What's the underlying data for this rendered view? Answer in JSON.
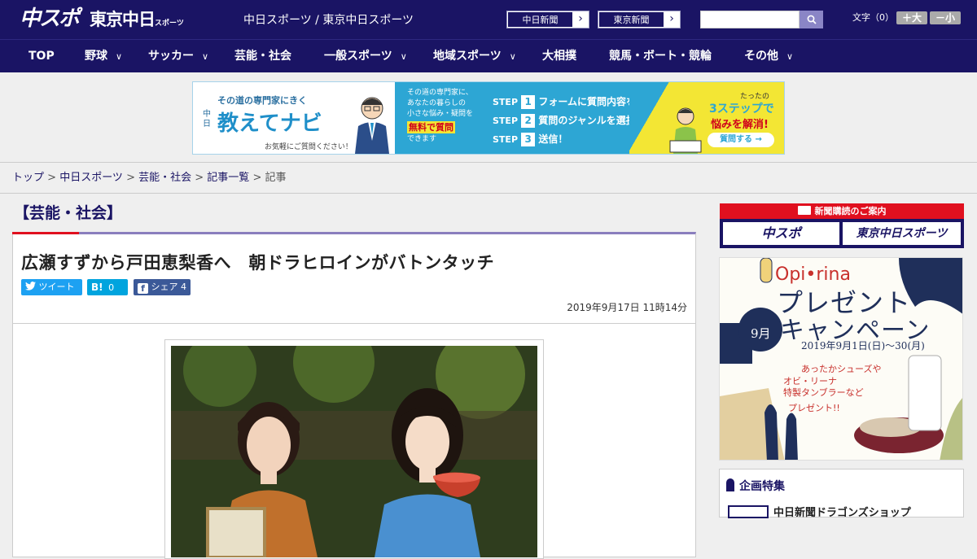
{
  "header": {
    "logo_main": "中スポ",
    "logo_tokyo": "東京中日",
    "logo_tokyo_sub": "スポーツ",
    "site_name": "中日スポーツ / 東京中日スポーツ",
    "paper_links": [
      "中日新聞",
      "東京新聞"
    ],
    "search_placeholder": "",
    "font_size_label": "文字（0）",
    "font_bigger": "＋大",
    "font_smaller": "－小"
  },
  "nav": [
    {
      "label": "TOP",
      "dropdown": false
    },
    {
      "label": "野球",
      "dropdown": true
    },
    {
      "label": "サッカー",
      "dropdown": true
    },
    {
      "label": "芸能・社会",
      "dropdown": false
    },
    {
      "label": "一般スポーツ",
      "dropdown": true
    },
    {
      "label": "地域スポーツ",
      "dropdown": true
    },
    {
      "label": "大相撲",
      "dropdown": false
    },
    {
      "label": "競馬・ボート・競輪",
      "dropdown": false
    },
    {
      "label": "その他",
      "dropdown": true
    }
  ],
  "banner": {
    "tagline": "その道の専門家にきく",
    "brand_prefix": "中日",
    "brand": "教えてナビ",
    "note": "お気軽にご質問ください！",
    "mid_lines": [
      "その道の専門家に、",
      "あなたの暮らしの",
      "小さな悩み・疑問を"
    ],
    "mid_highlight": "無料で質問",
    "mid_tail": "できます",
    "steps": [
      {
        "num": "1",
        "text": "フォームに質問内容を入力"
      },
      {
        "num": "2",
        "text": "質問のジャンルを選択"
      },
      {
        "num": "3",
        "text": "送信！"
      }
    ],
    "step_word": "STEP",
    "right_small": "たったの",
    "right_big": "3ステップで",
    "right_big2": "悩みを解消!",
    "right_button": "質問する"
  },
  "breadcrumb": [
    "トップ",
    "中日スポーツ",
    "芸能・社会",
    "記事一覧",
    "記事"
  ],
  "article": {
    "category": "【芸能・社会】",
    "headline": "広瀬すずから戸田恵梨香へ　朝ドラヒロインがバトンタッチ",
    "share": {
      "tweet": "ツイート",
      "hatena_count": "0",
      "facebook": "シェア",
      "facebook_count": "4"
    },
    "date": "2019年9月17日 11時14分"
  },
  "sidebar": {
    "subscribe_title": "新聞購読のご案内",
    "subscribe_buttons": [
      "中スポ",
      "東京中日スポーツ"
    ],
    "ad": {
      "brand": "Opi•rina",
      "title1": "プレゼント",
      "title2": "キャンペーン",
      "month": "9月",
      "period": "2019年9月1日(日)〜30(月)",
      "copy1": "あったかシューズや",
      "copy2": "オビ・リーナ",
      "copy3": "特製タンブラーなど",
      "copy4": "プレゼント!!"
    },
    "feature_title": "企画特集",
    "feature_item": "中日新聞ドラゴンズショップ"
  },
  "colors": {
    "navy": "#1a1464",
    "accent_red": "#e0101f",
    "twitter": "#1da1f2",
    "hatena": "#00a4de",
    "facebook": "#3b5998"
  }
}
